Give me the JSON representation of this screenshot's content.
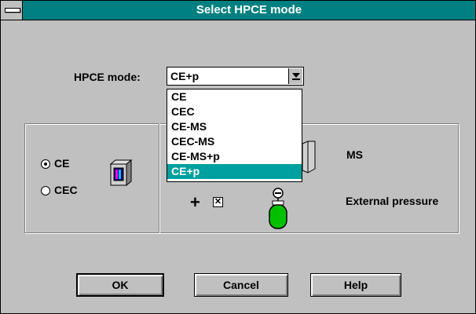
{
  "window": {
    "title": "Select HPCE mode"
  },
  "mode": {
    "label": "HPCE mode:",
    "selected": "CE+p",
    "options": [
      "CE",
      "CEC",
      "CE-MS",
      "CEC-MS",
      "CE-MS+p",
      "CE+p"
    ],
    "highlighted_index": 5
  },
  "left_group": {
    "radios": [
      {
        "label": "CE",
        "checked": true
      },
      {
        "label": "CEC",
        "checked": false
      }
    ]
  },
  "right_group": {
    "ms_label": "MS",
    "plus_symbol": "+",
    "external_pressure_checked": true,
    "external_pressure_label": "External pressure"
  },
  "buttons": {
    "ok": "OK",
    "cancel": "Cancel",
    "help": "Help"
  },
  "colors": {
    "title_bar": "#008080",
    "dialog_bg": "#c0c0c0",
    "highlight": "#00a0a0",
    "gauge": "#00c000"
  }
}
